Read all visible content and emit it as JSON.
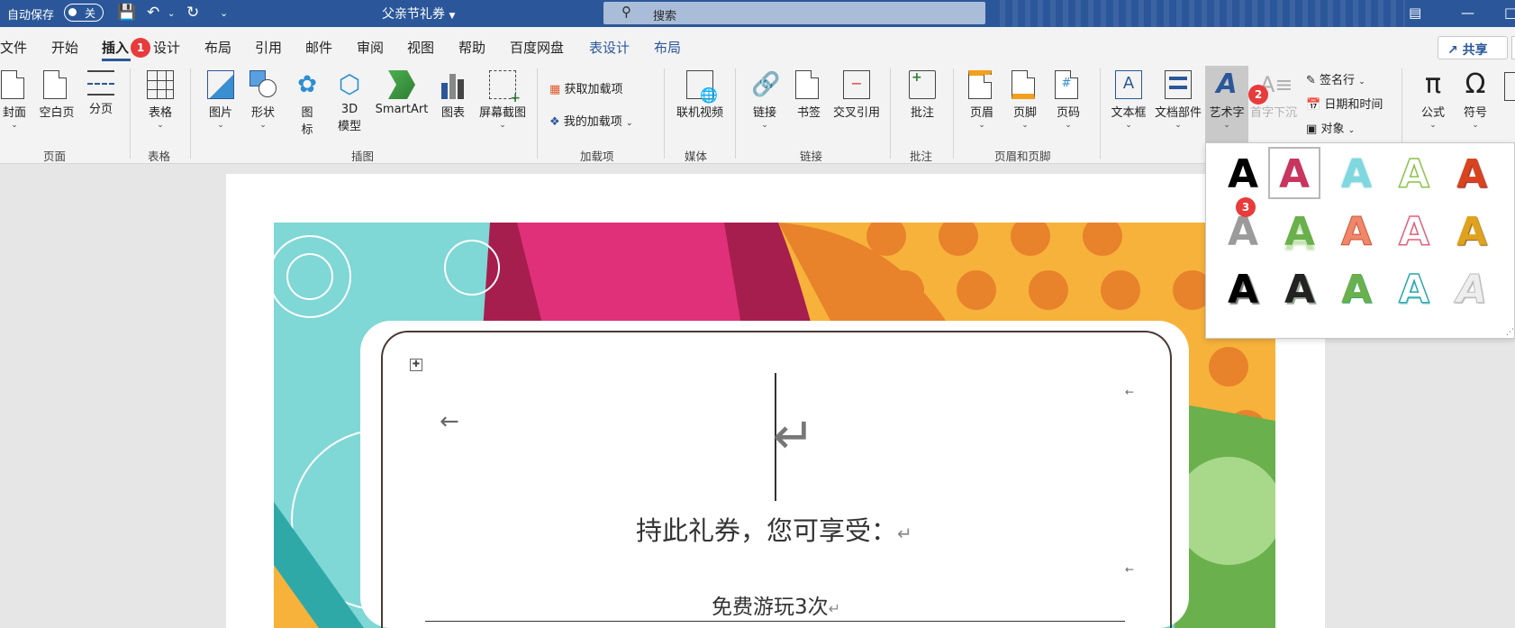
{
  "titlebar": {
    "autosave_label": "自动保存",
    "toggle_state": "关",
    "doc_title": "父亲节礼券",
    "search_placeholder": "搜索"
  },
  "tabs": [
    "文件",
    "开始",
    "插入",
    "设计",
    "布局",
    "引用",
    "邮件",
    "审阅",
    "视图",
    "帮助",
    "百度网盘",
    "表设计",
    "布局"
  ],
  "active_tab": "插入",
  "share_label": "共享",
  "ribbon": {
    "pages": {
      "cover": "封面",
      "blank": "空白页",
      "break": "分页",
      "group": "页面"
    },
    "table": {
      "label": "表格",
      "group": "表格"
    },
    "illustrations": {
      "pictures": "图片",
      "shapes": "形状",
      "icons1": "图",
      "icons2": "标",
      "model1": "3D",
      "model2": "模型",
      "smartart": "SmartArt",
      "chart": "图表",
      "screenshot": "屏幕截图",
      "group": "插图"
    },
    "addins": {
      "get": "获取加载项",
      "my": "我的加载项",
      "group": "加载项"
    },
    "media": {
      "video": "联机视频",
      "group": "媒体"
    },
    "links": {
      "link": "链接",
      "bookmark": "书签",
      "crossref": "交叉引用",
      "group": "链接"
    },
    "comments": {
      "comment": "批注",
      "group": "批注"
    },
    "headerfooter": {
      "header": "页眉",
      "footer": "页脚",
      "pagenum": "页码",
      "group": "页眉和页脚"
    },
    "text": {
      "textbox": "文本框",
      "quickparts": "文档部件",
      "wordart": "艺术字",
      "dropcap": "首字下沉",
      "signature": "签名行",
      "datetime": "日期和时间",
      "object": "对象"
    },
    "symbols": {
      "equation": "公式",
      "symbol": "符号"
    }
  },
  "badges": [
    "1",
    "2",
    "3"
  ],
  "document": {
    "line1": "持此礼券，您可享受：",
    "line2": "免费游玩3次"
  },
  "wordart_letter": "A",
  "colors": {
    "accent": "#2b579a",
    "badge": "#e83b3b"
  }
}
